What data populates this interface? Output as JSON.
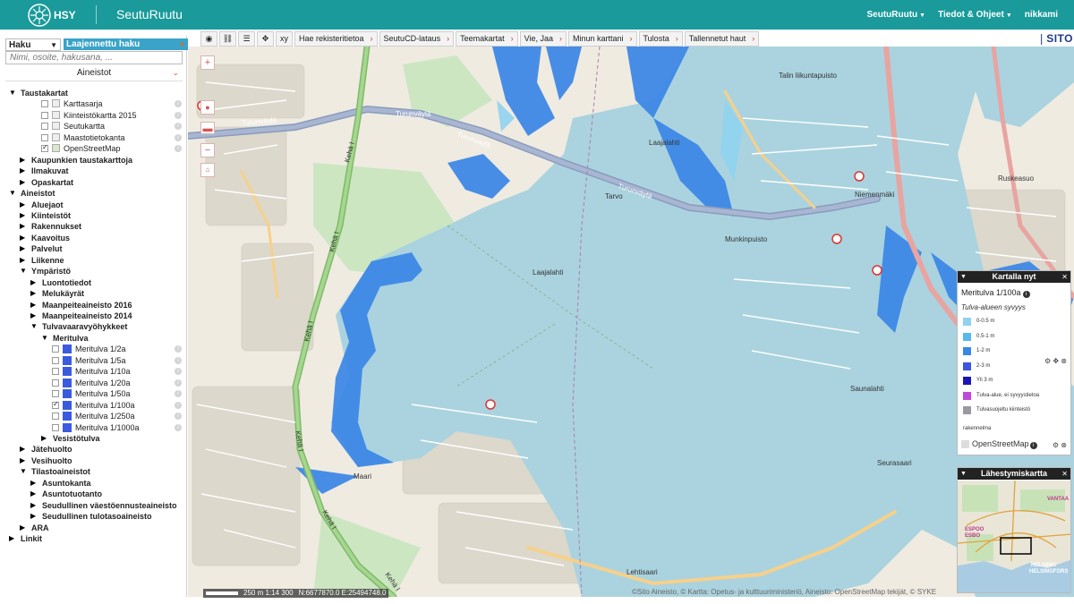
{
  "header": {
    "logo_text": "HSY",
    "app_title": "SeutuRuutu",
    "nav": [
      {
        "label": "SeutuRuutu"
      },
      {
        "label": "Tiedot & Ohjeet"
      },
      {
        "label": "nikkami"
      }
    ],
    "brand_color": "#1a9a9a"
  },
  "search": {
    "tab_label": "Haku",
    "advanced_label": "Laajennettu haku",
    "placeholder": "Nimi, osoite, hakusana, ..."
  },
  "layers_panel": {
    "title": "Aineistot",
    "tree": [
      {
        "label": "Taustakartat",
        "level": 0,
        "state": "open"
      },
      {
        "label": "Karttasarja",
        "level": 1,
        "checked": false,
        "type": "thumb"
      },
      {
        "label": "Kiinteistökartta 2015",
        "level": 1,
        "checked": false,
        "type": "thumb"
      },
      {
        "label": "Seutukartta",
        "level": 1,
        "checked": false,
        "type": "thumb"
      },
      {
        "label": "Maastotietokanta",
        "level": 1,
        "checked": false,
        "type": "thumb"
      },
      {
        "label": "OpenStreetMap",
        "level": 1,
        "checked": true,
        "type": "thumb"
      },
      {
        "label": "Kaupunkien taustakarttoja",
        "level": 1,
        "state": "closed"
      },
      {
        "label": "Ilmakuvat",
        "level": 1,
        "state": "closed"
      },
      {
        "label": "Opaskartat",
        "level": 1,
        "state": "closed"
      },
      {
        "label": "Aineistot",
        "level": 0,
        "state": "open"
      },
      {
        "label": "Aluejaot",
        "level": 1,
        "state": "closed"
      },
      {
        "label": "Kiinteistöt",
        "level": 1,
        "state": "closed"
      },
      {
        "label": "Rakennukset",
        "level": 1,
        "state": "closed"
      },
      {
        "label": "Kaavoitus",
        "level": 1,
        "state": "closed"
      },
      {
        "label": "Palvelut",
        "level": 1,
        "state": "closed"
      },
      {
        "label": "Liikenne",
        "level": 1,
        "state": "closed"
      },
      {
        "label": "Ympäristö",
        "level": 1,
        "state": "open"
      },
      {
        "label": "Luontotiedot",
        "level": 2,
        "state": "closed"
      },
      {
        "label": "Melukäyrät",
        "level": 2,
        "state": "closed"
      },
      {
        "label": "Maanpeiteaineisto 2016",
        "level": 2,
        "state": "closed"
      },
      {
        "label": "Maanpeiteaineisto 2014",
        "level": 2,
        "state": "closed"
      },
      {
        "label": "Tulvavaaravyöhykkeet",
        "level": 2,
        "state": "open"
      },
      {
        "label": "Meritulva",
        "level": 3,
        "state": "open"
      },
      {
        "label": "Meritulva 1/2a",
        "level": 4,
        "checked": false,
        "type": "swatch"
      },
      {
        "label": "Meritulva 1/5a",
        "level": 4,
        "checked": false,
        "type": "swatch"
      },
      {
        "label": "Meritulva 1/10a",
        "level": 4,
        "checked": false,
        "type": "swatch"
      },
      {
        "label": "Meritulva 1/20a",
        "level": 4,
        "checked": false,
        "type": "swatch"
      },
      {
        "label": "Meritulva 1/50a",
        "level": 4,
        "checked": false,
        "type": "swatch"
      },
      {
        "label": "Meritulva 1/100a",
        "level": 4,
        "checked": true,
        "type": "swatch"
      },
      {
        "label": "Meritulva 1/250a",
        "level": 4,
        "checked": false,
        "type": "swatch"
      },
      {
        "label": "Meritulva 1/1000a",
        "level": 4,
        "checked": false,
        "type": "swatch"
      },
      {
        "label": "Vesistötulva",
        "level": 3,
        "state": "closed"
      },
      {
        "label": "Jätehuolto",
        "level": 1,
        "state": "closed"
      },
      {
        "label": "Vesihuolto",
        "level": 1,
        "state": "closed"
      },
      {
        "label": "Tilastoaineistot",
        "level": 1,
        "state": "open"
      },
      {
        "label": "Asuntokanta",
        "level": 2,
        "state": "closed"
      },
      {
        "label": "Asuntotuotanto",
        "level": 2,
        "state": "closed"
      },
      {
        "label": "Seudullinen väestöennusteaineisto",
        "level": 2,
        "state": "closed"
      },
      {
        "label": "Seudullinen tulotasoaineisto",
        "level": 2,
        "state": "closed"
      },
      {
        "label": "ARA",
        "level": 1,
        "state": "closed"
      },
      {
        "label": "Linkit",
        "level": 0,
        "state": "closed"
      }
    ]
  },
  "toolbar": {
    "icons": [
      {
        "name": "select-tool-icon",
        "glyph": "◉"
      },
      {
        "name": "link-icon",
        "glyph": "⛓"
      },
      {
        "name": "list-icon",
        "glyph": "☰"
      },
      {
        "name": "pan-icon",
        "glyph": "✥"
      },
      {
        "name": "coordinates-icon",
        "glyph": "xy"
      }
    ],
    "menus": [
      {
        "label": "Hae rekisteritietoa"
      },
      {
        "label": "SeutuCD-lataus"
      },
      {
        "label": "Teemakartat"
      },
      {
        "label": "Vie, Jaa"
      },
      {
        "label": "Minun karttani"
      },
      {
        "label": "Tulosta"
      },
      {
        "label": "Tallennetut haut"
      }
    ],
    "sito_logo": "SITO"
  },
  "map_labels": [
    "Turunväylä",
    "Turunväylä",
    "Turunväylä",
    "Turunväylä",
    "Kehä I",
    "Kehä I",
    "Kehä I",
    "Kehä I",
    "Kehä I",
    "Kehä I",
    "Tarvo",
    "Laajalahti",
    "Maari",
    "Saunalahti",
    "Lehtisaari",
    "Talin liikuntapuisto",
    "Munkinpuisto",
    "Niemenmäki",
    "Ruskeasuo",
    "Seurasaari",
    "Laajalahti"
  ],
  "zoom_controls": {
    "in": "+",
    "out": "−"
  },
  "legend_panel": {
    "title": "Kartalla nyt",
    "layer": "Meritulva 1/100a",
    "subtitle": "Tulva-alueen syvyys",
    "items": [
      {
        "label": "0-0.5 m",
        "color": "#8fd3f0"
      },
      {
        "label": "0.5-1 m",
        "color": "#58b8ec"
      },
      {
        "label": "1-2 m",
        "color": "#3a86e6"
      },
      {
        "label": "2-3 m",
        "color": "#3c55e2"
      },
      {
        "label": "Yli 3 m",
        "color": "#1c14b8"
      },
      {
        "label": "Tulva-alue, ei syvyystietoa",
        "color": "#c248dd"
      },
      {
        "label": "Tulvasuojeltu kiinteistö",
        "color": "#9a9aa3"
      }
    ],
    "extra_text": "rakennelma",
    "base_layer": "OpenStreetMap"
  },
  "overview_panel": {
    "title": "Lähestymiskartta",
    "labels": [
      "ESPOO",
      "ESBO",
      "HELSINKI",
      "HELSINGFORS",
      "VANTAA"
    ]
  },
  "scalebar": {
    "scale_text": "250 m 1:14 300",
    "coords": "N:6677870.0 E:25494748.0"
  },
  "attribution": "©Sito Aineisto, © Kartta: Opetus- ja kulttuuriministeriö, Aineisto: OpenStreetMap tekijät, © SYKE"
}
